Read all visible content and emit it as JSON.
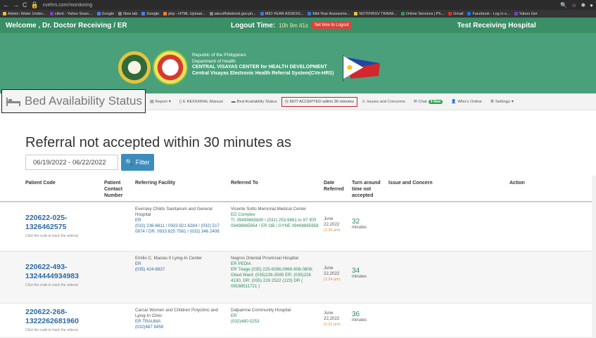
{
  "browser": {
    "url": "cvehrs.com/monitoring",
    "bookmarks": [
      {
        "label": "Admin: Water Under...",
        "color": "#f0c23a"
      },
      {
        "label": "client - Yahoo Searc...",
        "color": "#7b3fbf"
      },
      {
        "label": "Google",
        "color": "#4285f4"
      },
      {
        "label": "New tab",
        "color": "#888888"
      },
      {
        "label": "Google",
        "color": "#4285f4"
      },
      {
        "label": "php - HTML Upload...",
        "color": "#f48024"
      },
      {
        "label": "atecoffsitebook.gov.ph...",
        "color": "#888888"
      },
      {
        "label": "MID-YEAR ASSESS...",
        "color": "#3a7bd5"
      },
      {
        "label": "Mid-Year Assessme...",
        "color": "#3a7bd5"
      },
      {
        "label": "NOTIFIRSV TRAINI...",
        "color": "#f0c23a"
      },
      {
        "label": "Online Services | Ph...",
        "color": "#2a9d5a"
      },
      {
        "label": "Gmail",
        "color": "#d93025"
      },
      {
        "label": "Facebook - Log in o...",
        "color": "#1877f2"
      },
      {
        "label": "Yahoo Ger",
        "color": "#7b3fbf"
      }
    ]
  },
  "header": {
    "welcome": "Welcome , Dr. Doctor Receiving / ER",
    "logout_label": "Logout Time:",
    "logout_time": "10h 9m 41s",
    "set_logout_btn": "Set time to Logout",
    "hospital": "Test Receiving Hospital"
  },
  "banner": {
    "line1": "Republic of the Philippines",
    "line2": "Department of Health",
    "line3": "CENTRAL VISAYAS CENTER for HEALTH DEVELOPMENT",
    "line4": "Central Visayas Electronic Health Referral System(CVe-HRS)"
  },
  "nav": {
    "bed_status": "Bed Availability Status",
    "report": "Report",
    "manual": "E REFERRAL Manual",
    "bed_small": "Bed Availability Status",
    "not_accepted": "NOT ACCEPTED within 30 minutes",
    "issues": "Issues and Concerns",
    "chat": "Chat",
    "chat_badge": "0 New",
    "whos_online": "Who's Online",
    "settings": "Settings"
  },
  "page": {
    "heading": "Referral not accepted within 30 minutes as",
    "date_range": "06/19/2022 - 06/22/2022",
    "filter_btn": "Filter"
  },
  "table": {
    "headers": {
      "patient_code": "Patient Code",
      "contact_number": "Patient Contact Number",
      "referring_facility": "Referring Facility",
      "referred_to": "Referred To",
      "date_referred": "Date Referred",
      "turnaround": "Turn around time not accepted",
      "issue": "Issue and Concern",
      "action": "Action"
    },
    "rows": [
      {
        "code": "220622-025-1326462575",
        "hint": "Click the code to track the referral",
        "fac_name": "Eversley Childs Sanitarium and General Hospital",
        "fac_dept": "ER",
        "fac_contact": "(032) 236-6811 / 0933 821 6284 / (032) 517 0874 / DR. 0933 825 7561 / (032) 346 2406",
        "to_name": "Vicente Sotto Memorial Medical Center",
        "to_dept": "ED Complex",
        "to_contact": "Tl. 09499865800 / (032) 253-9891 to 97 /ER 09498865954 / ER OB / GYNE 09498865958",
        "date": "June 22,2022",
        "time": "(1:26 pm)",
        "turn": "32",
        "unit": "minutes"
      },
      {
        "code": "220622-493-1324444934983",
        "hint": "Click the code to track the referral",
        "fac_name": "Emilio C. Macias II Lying-In Center",
        "fac_dept": "ER",
        "fac_contact": "(035) 424-8837",
        "to_name": "Negros Oriental Provincial Hospital",
        "to_dept": "ER PEDIA",
        "to_contact": "ER Triage (035) 225-9266,0966-908-0808; Gbed Ward: (035)226-3595 ER: (035)226 4130, DR: (035) 226 2522 (123) DR ( 09168511721 )",
        "date": "June 22,2022",
        "time": "(1:24 pm)",
        "turn": "34",
        "unit": "minutes"
      },
      {
        "code": "220622-268-1322262681960",
        "hint": "Click the code to track the referral",
        "fac_name": "Carcar Women and Children Polyclinic and Lying-In Clinic",
        "fac_dept": "ER TRAUMA",
        "fac_contact": "(032)487 8458",
        "to_name": "Dalpamne Community Hospital",
        "to_dept": "ER",
        "to_contact": "(032)480-5253",
        "date": "June 22,2022",
        "time": "(1:22 pm)",
        "turn": "36",
        "unit": "minutes"
      }
    ]
  }
}
